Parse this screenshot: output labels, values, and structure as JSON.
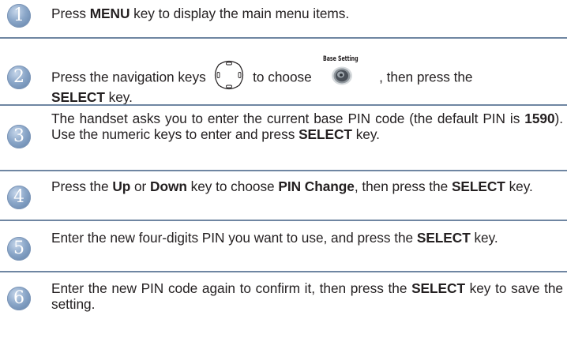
{
  "steps": [
    {
      "number": "1",
      "parts": {
        "t1": "Press ",
        "b1": "MENU",
        "t2": " key to display the main menu items."
      }
    },
    {
      "number": "2",
      "parts": {
        "t1": "Press the navigation keys ",
        "t2": " to choose ",
        "t3": " , then press the ",
        "b1": "SELECT",
        "t4": " key."
      },
      "icons": {
        "nav_keys": "navigation-keys-icon",
        "base_setting": "base-setting-icon"
      },
      "base_setting_caption": "Base Setting"
    },
    {
      "number": "3",
      "parts": {
        "t1": "The handset asks you to enter the current base PIN code (the default PIN is ",
        "b1": "1590",
        "t2": "). Use the numeric keys to enter and press ",
        "b2": "SELECT",
        "t3": " key."
      }
    },
    {
      "number": "4",
      "parts": {
        "t1": "Press the ",
        "b1": "Up",
        "t2": " or ",
        "b2": "Down",
        "t3": " key to choose ",
        "b3": "PIN Change",
        "t4": ", then press the ",
        "b4": "SELECT",
        "t5": " key."
      }
    },
    {
      "number": "5",
      "parts": {
        "t1": "Enter the new four-digits PIN you want to use, and press the ",
        "b1": "SELECT",
        "t2": " key."
      }
    },
    {
      "number": "6",
      "parts": {
        "t1": "Enter the new PIN code again to confirm it, then press the ",
        "b1": "SELECT",
        "t2": " key to save the setting."
      }
    }
  ],
  "colors": {
    "badge": "#7f9cc2",
    "separator": "#6f86a2",
    "text": "#231f20"
  }
}
